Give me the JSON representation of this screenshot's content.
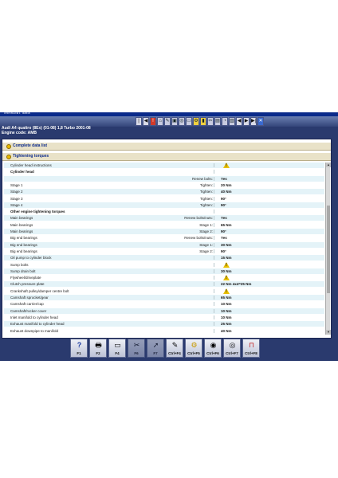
{
  "window": {
    "title": "Technical data"
  },
  "vehicle": {
    "line1": "Audi   A4 quattro (8Ex) (01-08) 1,8 Turbo 2001-08",
    "line2": "Engine code: AMB"
  },
  "sections": {
    "complete": "Complete data list",
    "tightening": "Tightening torques"
  },
  "rows": [
    {
      "label": "Cylinder head instructions",
      "mid": "",
      "value": "",
      "warn": true,
      "bold": false
    },
    {
      "label": "Cylinder head",
      "mid": "",
      "value": "",
      "warn": false,
      "bold": true
    },
    {
      "label": "",
      "mid": "Renew bolts:",
      "value": "Yes",
      "warn": false,
      "bold": false
    },
    {
      "label": "Stage 1",
      "mid": "Tighten:",
      "value": "20 Nm",
      "warn": false,
      "bold": false
    },
    {
      "label": "Stage 2",
      "mid": "Tighten:",
      "value": "40 Nm",
      "warn": false,
      "bold": false
    },
    {
      "label": "Stage 3",
      "mid": "Tighten:",
      "value": "90°",
      "warn": false,
      "bold": false
    },
    {
      "label": "Stage 4",
      "mid": "Tighten:",
      "value": "90°",
      "warn": false,
      "bold": false
    },
    {
      "label": "Other engine tightening torques",
      "mid": "",
      "value": "",
      "warn": false,
      "bold": true
    },
    {
      "label": "Main bearings",
      "mid": "Renew bolts/nuts:",
      "value": "Yes",
      "warn": false,
      "bold": false
    },
    {
      "label": "Main bearings",
      "mid": "Stage 1:",
      "value": "65 Nm",
      "warn": false,
      "bold": false
    },
    {
      "label": "Main bearings",
      "mid": "Stage 2:",
      "value": "90°",
      "warn": false,
      "bold": false
    },
    {
      "label": "Big end bearings",
      "mid": "Renew bolts/nuts:",
      "value": "Yes",
      "warn": false,
      "bold": false
    },
    {
      "label": "Big end bearings",
      "mid": "Stage 1:",
      "value": "30 Nm",
      "warn": false,
      "bold": false
    },
    {
      "label": "Big end bearings",
      "mid": "Stage 2:",
      "value": "90°",
      "warn": false,
      "bold": false
    },
    {
      "label": "Oil pump to cylinder block",
      "mid": "",
      "value": "15 Nm",
      "warn": false,
      "bold": false
    },
    {
      "label": "Sump bolts",
      "mid": "",
      "value": "",
      "warn": true,
      "bold": false
    },
    {
      "label": "Sump drain bolt",
      "mid": "",
      "value": "30 Nm",
      "warn": false,
      "bold": false
    },
    {
      "label": "Flywheel/driveplate",
      "mid": "",
      "value": "",
      "warn": true,
      "bold": false
    },
    {
      "label": "Clutch pressure plate",
      "mid": "",
      "value": "22 Nm 4x4=25 Nm",
      "warn": false,
      "bold": false
    },
    {
      "label": "Crankshaft pulley/damper centre bolt",
      "mid": "",
      "value": "",
      "warn": true,
      "bold": false
    },
    {
      "label": "Camshaft sprocket/gear",
      "mid": "",
      "value": "65 Nm",
      "warn": false,
      "bold": false
    },
    {
      "label": "Camshaft carrier/cap",
      "mid": "",
      "value": "10 Nm",
      "warn": false,
      "bold": false
    },
    {
      "label": "Camshaft/rocker cover",
      "mid": "",
      "value": "10 Nm",
      "warn": false,
      "bold": false
    },
    {
      "label": "Inlet manifold to cylinder head",
      "mid": "",
      "value": "10 Nm",
      "warn": false,
      "bold": false
    },
    {
      "label": "Exhaust manifold to cylinder head",
      "mid": "",
      "value": "25 Nm",
      "warn": false,
      "bold": false
    },
    {
      "label": "Exhaust downpipe to manifold",
      "mid": "",
      "value": "40 Nm",
      "warn": false,
      "bold": false
    }
  ],
  "toolbar_icons": [
    "first-icon",
    "prev-icon",
    "warning-icon",
    "home-icon",
    "note-icon",
    "camera-icon",
    "wheel-icon",
    "car-icon",
    "engine-icon",
    "fuel-icon",
    "tool-icon",
    "chart-icon",
    "gauge-icon",
    "print-icon",
    "prev2-icon",
    "next-icon",
    "last-icon",
    "exit-icon"
  ],
  "fkeys": [
    {
      "label": "F1",
      "icon": "help-icon",
      "glyph": "?",
      "disabled": false
    },
    {
      "label": "F2",
      "icon": "print-icon",
      "glyph": "🖶",
      "disabled": false
    },
    {
      "label": "F4",
      "icon": "screen-icon",
      "glyph": "▭",
      "disabled": false
    },
    {
      "label": "F6",
      "icon": "tools-icon",
      "glyph": "✂",
      "disabled": true
    },
    {
      "label": "F7",
      "icon": "pointer-icon",
      "glyph": "➚",
      "disabled": true
    },
    {
      "label": "Ctrl+F4",
      "icon": "notepad-icon",
      "glyph": "✎",
      "disabled": false
    },
    {
      "label": "Ctrl+F5",
      "icon": "gear-yellow-icon",
      "glyph": "⚙",
      "disabled": false
    },
    {
      "label": "Ctrl+F6",
      "icon": "circle-icon",
      "glyph": "◉",
      "disabled": false
    },
    {
      "label": "Ctrl+F7",
      "icon": "tyre-icon",
      "glyph": "◎",
      "disabled": false
    },
    {
      "label": "Ctrl+F8",
      "icon": "lift-icon",
      "glyph": "⊓",
      "disabled": false
    }
  ],
  "colors": {
    "row_alt": "#e4f3f8",
    "header_bg": "#e9e2c8",
    "app_bg": "#2a3a6e",
    "accent": "#0b2a8c",
    "warn": "#e8c000"
  }
}
